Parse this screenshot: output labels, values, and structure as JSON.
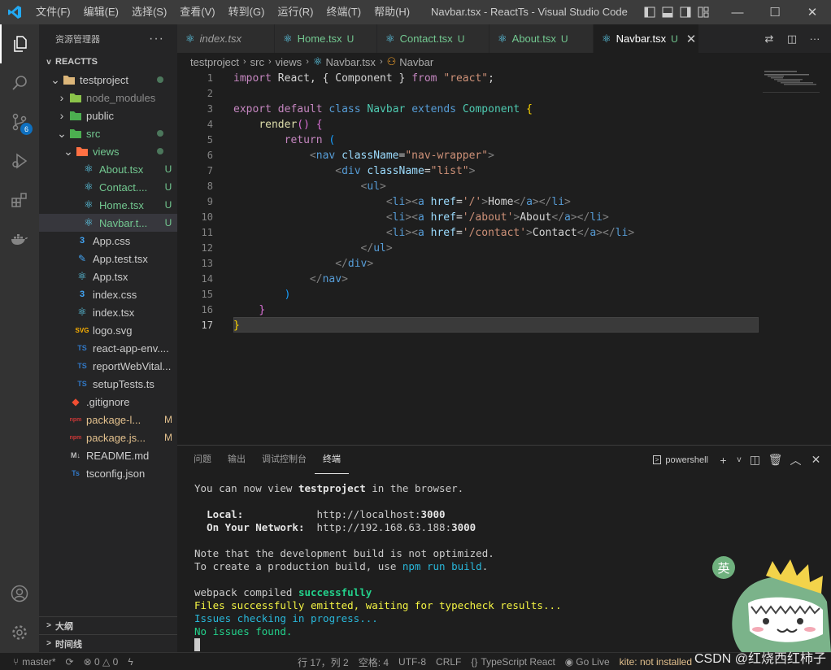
{
  "titlebar": {
    "menu": [
      "文件(F)",
      "编辑(E)",
      "选择(S)",
      "查看(V)",
      "转到(G)",
      "运行(R)",
      "终端(T)",
      "帮助(H)"
    ],
    "title": "Navbar.tsx - ReactTs - Visual Studio Code"
  },
  "activity": {
    "scm_badge": "6"
  },
  "sidebar": {
    "header": "资源管理器",
    "section": "REACTTS",
    "tree": [
      {
        "name": "testproject",
        "indent": 1,
        "chev": "v",
        "icon": "folder",
        "color": "gray",
        "dot": true
      },
      {
        "name": "node_modules",
        "indent": 2,
        "chev": ">",
        "icon": "node",
        "color": "gray",
        "dim": true
      },
      {
        "name": "public",
        "indent": 2,
        "chev": ">",
        "icon": "public",
        "color": "gray"
      },
      {
        "name": "src",
        "indent": 2,
        "chev": "v",
        "icon": "src",
        "color": "green",
        "dot": true
      },
      {
        "name": "views",
        "indent": 3,
        "chev": "v",
        "icon": "views",
        "color": "green",
        "dot": true
      },
      {
        "name": "About.tsx",
        "indent": 4,
        "icon": "react",
        "color": "green",
        "stat": "U"
      },
      {
        "name": "Contact....",
        "indent": 4,
        "icon": "react",
        "color": "green",
        "stat": "U"
      },
      {
        "name": "Home.tsx",
        "indent": 4,
        "icon": "react",
        "color": "green",
        "stat": "U"
      },
      {
        "name": "Navbar.t...",
        "indent": 4,
        "icon": "react",
        "color": "green",
        "stat": "U",
        "selected": true
      },
      {
        "name": "App.css",
        "indent": 3,
        "icon": "css",
        "color": "gray"
      },
      {
        "name": "App.test.tsx",
        "indent": 3,
        "icon": "test",
        "color": "gray"
      },
      {
        "name": "App.tsx",
        "indent": 3,
        "icon": "react",
        "color": "gray"
      },
      {
        "name": "index.css",
        "indent": 3,
        "icon": "css",
        "color": "gray"
      },
      {
        "name": "index.tsx",
        "indent": 3,
        "icon": "react",
        "color": "gray"
      },
      {
        "name": "logo.svg",
        "indent": 3,
        "icon": "svg",
        "color": "gray"
      },
      {
        "name": "react-app-env....",
        "indent": 3,
        "icon": "ts",
        "color": "gray"
      },
      {
        "name": "reportWebVital...",
        "indent": 3,
        "icon": "ts",
        "color": "gray"
      },
      {
        "name": "setupTests.ts",
        "indent": 3,
        "icon": "ts",
        "color": "gray"
      },
      {
        "name": ".gitignore",
        "indent": 2,
        "icon": "git",
        "color": "gray"
      },
      {
        "name": "package-l...",
        "indent": 2,
        "icon": "npm",
        "color": "mod",
        "stat": "M"
      },
      {
        "name": "package.js...",
        "indent": 2,
        "icon": "npm",
        "color": "mod",
        "stat": "M"
      },
      {
        "name": "README.md",
        "indent": 2,
        "icon": "md",
        "color": "gray"
      },
      {
        "name": "tsconfig.json",
        "indent": 2,
        "icon": "tsconfig",
        "color": "gray"
      }
    ],
    "outline": "大纲",
    "timeline": "时间线"
  },
  "tabs": [
    {
      "name": "index.tsx",
      "italic": true,
      "stat": ""
    },
    {
      "name": "Home.tsx",
      "stat": "U"
    },
    {
      "name": "Contact.tsx",
      "stat": "U"
    },
    {
      "name": "About.tsx",
      "stat": "U"
    },
    {
      "name": "Navbar.tsx",
      "stat": "U",
      "active": true
    }
  ],
  "breadcrumb": [
    "testproject",
    "src",
    "views",
    "Navbar.tsx",
    "Navbar"
  ],
  "editor": {
    "current_line": 17,
    "lines": [
      [
        [
          "import",
          "t-kw"
        ],
        [
          " React, { ",
          "t-tx"
        ],
        [
          "Component",
          "t-tx"
        ],
        [
          " } ",
          "t-tx"
        ],
        [
          "from",
          "t-kw"
        ],
        [
          " ",
          "t-tx"
        ],
        [
          "\"react\"",
          "t-str"
        ],
        [
          ";",
          "t-tx"
        ]
      ],
      [],
      [
        [
          "export",
          "t-kw"
        ],
        [
          " ",
          "t-tx"
        ],
        [
          "default",
          "t-kw"
        ],
        [
          " ",
          "t-tx"
        ],
        [
          "class",
          "t-st"
        ],
        [
          " ",
          "t-tx"
        ],
        [
          "Navbar",
          "t-cls"
        ],
        [
          " ",
          "t-tx"
        ],
        [
          "extends",
          "t-st"
        ],
        [
          " ",
          "t-tx"
        ],
        [
          "Component",
          "t-cls"
        ],
        [
          " ",
          "t-tx"
        ],
        [
          "{",
          "t-b1"
        ]
      ],
      [
        [
          "    ",
          "t-tx"
        ],
        [
          "render",
          "t-fn"
        ],
        [
          "()",
          "t-b2"
        ],
        [
          " ",
          "t-tx"
        ],
        [
          "{",
          "t-b2"
        ]
      ],
      [
        [
          "        ",
          "t-tx"
        ],
        [
          "return",
          "t-kw"
        ],
        [
          " ",
          "t-tx"
        ],
        [
          "(",
          "t-b3"
        ]
      ],
      [
        [
          "            ",
          "t-tx"
        ],
        [
          "<",
          "t-gray"
        ],
        [
          "nav",
          "t-tag"
        ],
        [
          " ",
          "t-tx"
        ],
        [
          "className",
          "t-attr"
        ],
        [
          "=",
          "t-tx"
        ],
        [
          "\"nav-wrapper\"",
          "t-str"
        ],
        [
          ">",
          "t-gray"
        ]
      ],
      [
        [
          "                ",
          "t-tx"
        ],
        [
          "<",
          "t-gray"
        ],
        [
          "div",
          "t-tag"
        ],
        [
          " ",
          "t-tx"
        ],
        [
          "className",
          "t-attr"
        ],
        [
          "=",
          "t-tx"
        ],
        [
          "\"list\"",
          "t-str"
        ],
        [
          ">",
          "t-gray"
        ]
      ],
      [
        [
          "                    ",
          "t-tx"
        ],
        [
          "<",
          "t-gray"
        ],
        [
          "ul",
          "t-tag"
        ],
        [
          ">",
          "t-gray"
        ]
      ],
      [
        [
          "                        ",
          "t-tx"
        ],
        [
          "<",
          "t-gray"
        ],
        [
          "li",
          "t-tag"
        ],
        [
          "><",
          "t-gray"
        ],
        [
          "a",
          "t-tag"
        ],
        [
          " ",
          "t-tx"
        ],
        [
          "href",
          "t-attr"
        ],
        [
          "=",
          "t-tx"
        ],
        [
          "'/'",
          "t-str"
        ],
        [
          ">",
          "t-gray"
        ],
        [
          "Home",
          "t-tx"
        ],
        [
          "</",
          "t-gray"
        ],
        [
          "a",
          "t-tag"
        ],
        [
          "></",
          "t-gray"
        ],
        [
          "li",
          "t-tag"
        ],
        [
          ">",
          "t-gray"
        ]
      ],
      [
        [
          "                        ",
          "t-tx"
        ],
        [
          "<",
          "t-gray"
        ],
        [
          "li",
          "t-tag"
        ],
        [
          "><",
          "t-gray"
        ],
        [
          "a",
          "t-tag"
        ],
        [
          " ",
          "t-tx"
        ],
        [
          "href",
          "t-attr"
        ],
        [
          "=",
          "t-tx"
        ],
        [
          "'/about'",
          "t-str"
        ],
        [
          ">",
          "t-gray"
        ],
        [
          "About",
          "t-tx"
        ],
        [
          "</",
          "t-gray"
        ],
        [
          "a",
          "t-tag"
        ],
        [
          "></",
          "t-gray"
        ],
        [
          "li",
          "t-tag"
        ],
        [
          ">",
          "t-gray"
        ]
      ],
      [
        [
          "                        ",
          "t-tx"
        ],
        [
          "<",
          "t-gray"
        ],
        [
          "li",
          "t-tag"
        ],
        [
          "><",
          "t-gray"
        ],
        [
          "a",
          "t-tag"
        ],
        [
          " ",
          "t-tx"
        ],
        [
          "href",
          "t-attr"
        ],
        [
          "=",
          "t-tx"
        ],
        [
          "'/contact'",
          "t-str"
        ],
        [
          ">",
          "t-gray"
        ],
        [
          "Contact",
          "t-tx"
        ],
        [
          "</",
          "t-gray"
        ],
        [
          "a",
          "t-tag"
        ],
        [
          "></",
          "t-gray"
        ],
        [
          "li",
          "t-tag"
        ],
        [
          ">",
          "t-gray"
        ]
      ],
      [
        [
          "                    ",
          "t-tx"
        ],
        [
          "</",
          "t-gray"
        ],
        [
          "ul",
          "t-tag"
        ],
        [
          ">",
          "t-gray"
        ]
      ],
      [
        [
          "                ",
          "t-tx"
        ],
        [
          "</",
          "t-gray"
        ],
        [
          "div",
          "t-tag"
        ],
        [
          ">",
          "t-gray"
        ]
      ],
      [
        [
          "            ",
          "t-tx"
        ],
        [
          "</",
          "t-gray"
        ],
        [
          "nav",
          "t-tag"
        ],
        [
          ">",
          "t-gray"
        ]
      ],
      [
        [
          "        ",
          "t-tx"
        ],
        [
          ")",
          "t-b3"
        ]
      ],
      [
        [
          "    ",
          "t-tx"
        ],
        [
          "}",
          "t-b2"
        ]
      ],
      [
        [
          "}",
          "t-b1"
        ]
      ]
    ]
  },
  "panel": {
    "tabs": [
      "问题",
      "输出",
      "调试控制台",
      "终端"
    ],
    "active_tab": "终端",
    "shell": "powershell",
    "terminal": [
      [
        [
          "You can now view ",
          ""
        ],
        [
          "testproject",
          "tb"
        ],
        [
          " in the browser.",
          ""
        ]
      ],
      [],
      [
        [
          "  ",
          ""
        ],
        [
          "Local:",
          "tb"
        ],
        [
          "            http://localhost:",
          ""
        ],
        [
          "3000",
          "tb"
        ]
      ],
      [
        [
          "  ",
          ""
        ],
        [
          "On Your Network:",
          "tb"
        ],
        [
          "  http://192.168.63.188:",
          ""
        ],
        [
          "3000",
          "tb"
        ]
      ],
      [],
      [
        [
          "Note that the development build is not optimized.",
          ""
        ]
      ],
      [
        [
          "To create a production build, use ",
          ""
        ],
        [
          "npm run build",
          "tc"
        ],
        [
          ".",
          ""
        ]
      ],
      [],
      [
        [
          "webpack compiled ",
          ""
        ],
        [
          "successfully",
          "tgb"
        ]
      ],
      [
        [
          "Files successfully emitted, waiting for typecheck results...",
          "ty"
        ]
      ],
      [
        [
          "Issues checking in progress...",
          "tc"
        ]
      ],
      [
        [
          "No issues found.",
          "tg"
        ]
      ]
    ]
  },
  "mascot_badge": "英",
  "statusbar": {
    "branch": "master*",
    "errors": "0",
    "warnings": "0",
    "position": "行 17，列 2",
    "spaces": "空格: 4",
    "encoding": "UTF-8",
    "eol": "CRLF",
    "language": "TypeScript React",
    "golive": "Go Live",
    "kite": "kite: not installed"
  },
  "watermark": "CSDN @红烧西红柿子"
}
